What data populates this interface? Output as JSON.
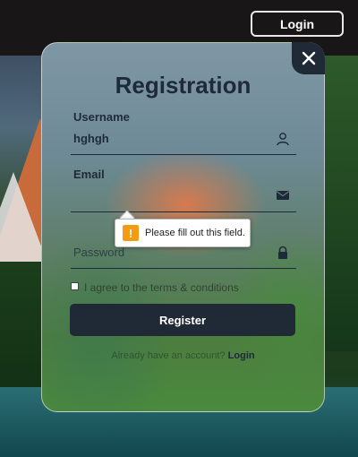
{
  "header": {
    "login_label": "Login"
  },
  "modal": {
    "title": "Registration",
    "close_icon": "close-icon",
    "username": {
      "label": "Username",
      "value": "hghgh",
      "icon": "user-icon"
    },
    "email": {
      "label": "Email",
      "value": "",
      "icon": "envelope-icon"
    },
    "password": {
      "placeholder": "Password",
      "icon": "lock-icon"
    },
    "terms_label": "I agree to the terms & conditions",
    "register_label": "Register",
    "already_text": "Already have an account?",
    "login_link": "Login"
  },
  "validation": {
    "message": "Please fill out this field.",
    "icon": "warning-icon"
  },
  "colors": {
    "dark": "#1f2a36",
    "warning": "#f39c12"
  }
}
